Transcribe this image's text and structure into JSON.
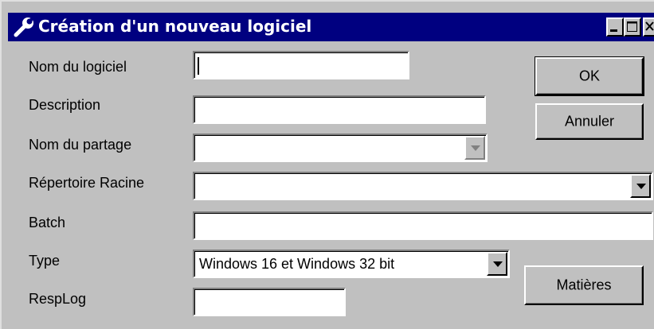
{
  "window": {
    "title": "Création d'un nouveau logiciel",
    "controls": {
      "minimize": "_",
      "maximize": "□",
      "close": "x"
    }
  },
  "form": {
    "nom_du_logiciel": {
      "label": "Nom du logiciel",
      "value": ""
    },
    "description": {
      "label": "Description",
      "value": ""
    },
    "nom_du_partage": {
      "label": "Nom du partage",
      "value": ""
    },
    "repertoire_racine": {
      "label": "Répertoire Racine",
      "value": ""
    },
    "batch": {
      "label": "Batch",
      "value": ""
    },
    "type": {
      "label": "Type",
      "value": "Windows 16 et Windows 32 bit"
    },
    "resplog": {
      "label": "RespLog",
      "value": ""
    }
  },
  "buttons": {
    "ok": "OK",
    "cancel": "Annuler",
    "matieres": "Matières"
  },
  "icons": {
    "title": "wrench-icon",
    "dropdown": "chevron-down-icon"
  },
  "colors": {
    "titlebar": "#000080",
    "face": "#c0c0c0",
    "field": "#ffffff"
  }
}
